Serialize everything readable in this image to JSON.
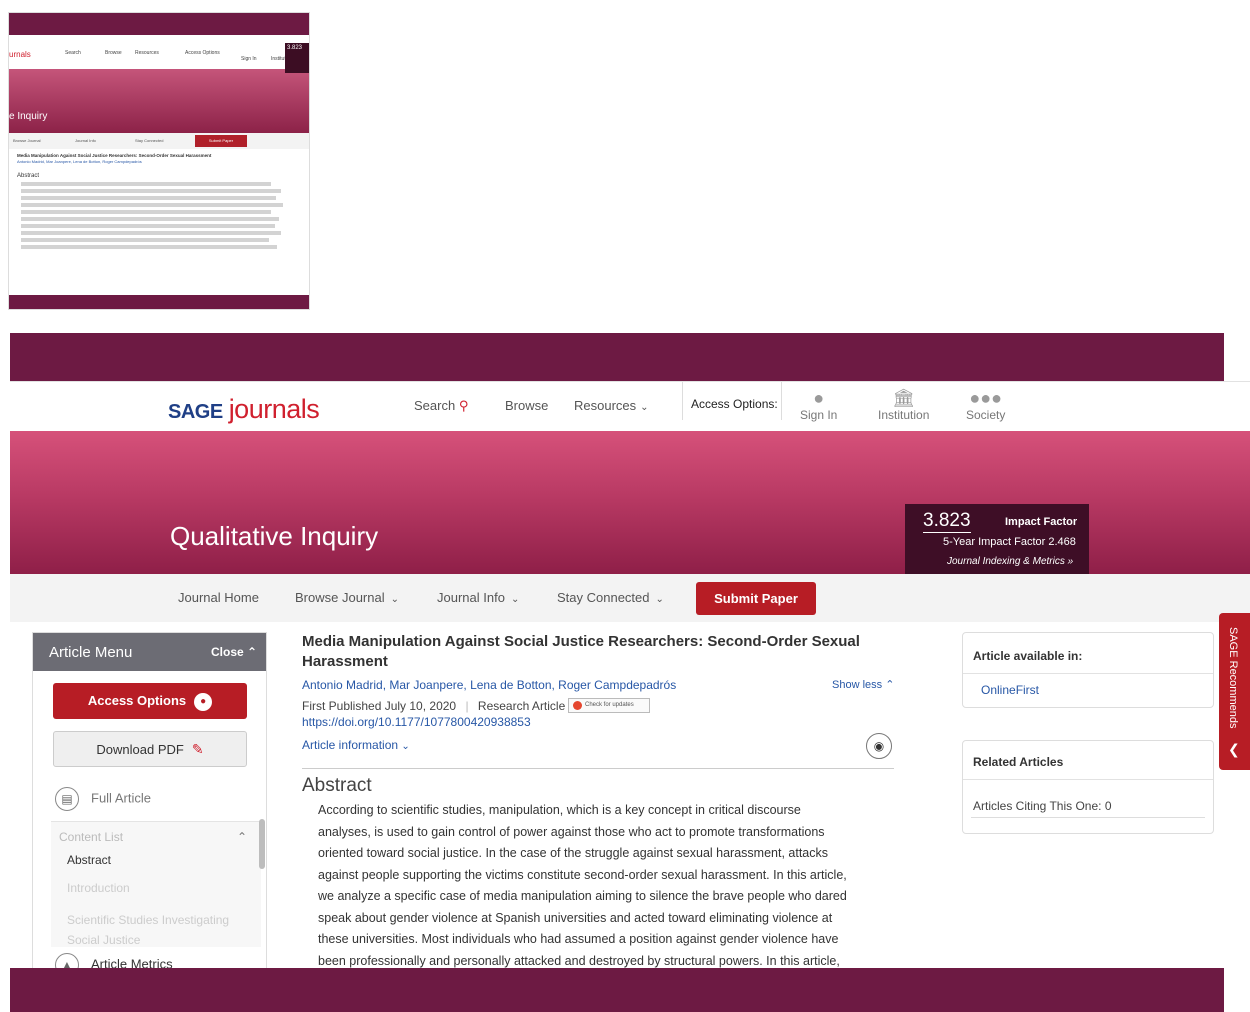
{
  "thumb": {
    "logo": "urnals",
    "nav": [
      "Search",
      "Browse",
      "Resources",
      "Access Options",
      "Sign In",
      "Institution"
    ],
    "title": "e Inquiry",
    "metric": "3.823",
    "bar": [
      "Browse Journal",
      "Journal Info",
      "Stay Connected"
    ],
    "submit": "Submit Paper",
    "article_title": "Media Manipulation Against Social Justice Researchers: Second-Order Sexual Harassment",
    "authors": "Antonio Madrid, Mar Joanpere, Lena de Botton, Roger Campdepadrós",
    "abstract_head": "Abstract"
  },
  "header": {
    "logo_brand": "SAGE",
    "logo_journals": "journals",
    "nav": {
      "search": "Search",
      "browse": "Browse",
      "resources": "Resources",
      "access_options": "Access Options:",
      "sign_in": "Sign In",
      "institution": "Institution",
      "society": "Society"
    }
  },
  "banner": {
    "journal_title": "Qualitative Inquiry",
    "impact_value": "3.823",
    "impact_label": "Impact Factor",
    "five_year": "5-Year Impact Factor 2.468",
    "indexing_link": "Journal Indexing & Metrics »"
  },
  "subnav": {
    "journal_home": "Journal Home",
    "browse_journal": "Browse Journal",
    "journal_info": "Journal Info",
    "stay_connected": "Stay Connected",
    "submit_paper": "Submit Paper"
  },
  "menu": {
    "title": "Article Menu",
    "close": "Close",
    "access_options": "Access Options",
    "download_pdf": "Download PDF",
    "full_article": "Full Article",
    "content_list": "Content List",
    "items": [
      "Abstract",
      "Introduction",
      "Scientific Studies Investigating Social Justice"
    ],
    "article_metrics": "Article Metrics"
  },
  "article": {
    "title": "Media Manipulation Against Social Justice Researchers: Second-Order Sexual Harassment",
    "authors": "Antonio Madrid, Mar Joanpere, Lena de Botton, Roger Campdepadrós",
    "show_less": "Show less",
    "published": "First Published July 10, 2020",
    "type": "Research Article",
    "check_updates": "Check for updates",
    "doi": "https://doi.org/10.1177/1077800420938853",
    "article_info": "Article information",
    "abstract_heading": "Abstract",
    "abstract_lines": [
      "According to scientific studies, manipulation, which is a key concept in critical discourse",
      "analyses, is used to gain control of power against those who act to promote transformations",
      "oriented toward social justice. In the case of the struggle against sexual harassment, attacks",
      "against people supporting the victims constitute second-order sexual harassment. In this article,",
      "we analyze a specific case of media manipulation aiming to silence the brave people who dared",
      "speak about gender violence at Spanish universities and acted toward eliminating violence at",
      "these universities. Most individuals who had assumed a position against gender violence have",
      "been professionally and personally attacked and destroyed by structural powers. In this article,"
    ]
  },
  "sidebar": {
    "available_heading": "Article available in:",
    "available_link": "OnlineFirst",
    "related_heading": "Related Articles",
    "citing": "Articles Citing This One: 0"
  },
  "recommends": "SAGE Recommends",
  "colors": {
    "brand": "#6d1a43",
    "accent": "#b71d25",
    "link": "#2757a6"
  }
}
